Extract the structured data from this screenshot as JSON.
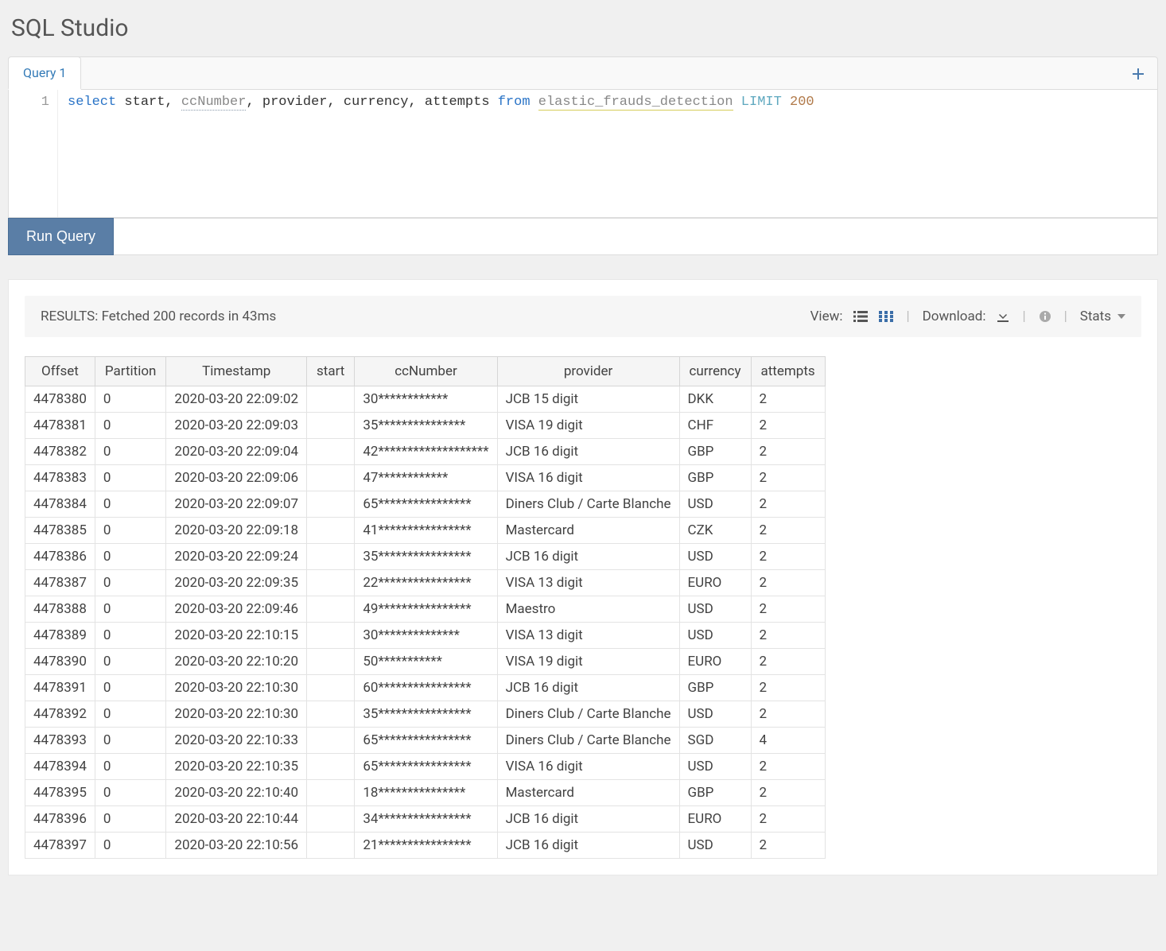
{
  "page_title": "SQL Studio",
  "tabs": [
    {
      "label": "Query 1"
    }
  ],
  "editor": {
    "line_number": "1",
    "tokens": {
      "select": "select",
      "fields": " start, ",
      "cc": "ccNumber",
      "rest": ", provider, currency, attempts ",
      "from": "from",
      "sp": " ",
      "table": "elastic_frauds_detection",
      "sp2": " ",
      "limit": "LIMIT",
      "sp3": " ",
      "num": "200"
    }
  },
  "run_button": "Run Query",
  "results": {
    "status": "RESULTS: Fetched 200 records in 43ms",
    "view_label": "View:",
    "download_label": "Download:",
    "stats_label": "Stats",
    "columns": [
      "Offset",
      "Partition",
      "Timestamp",
      "start",
      "ccNumber",
      "provider",
      "currency",
      "attempts"
    ],
    "rows": [
      {
        "offset": "4478380",
        "partition": "0",
        "timestamp": "2020-03-20 22:09:02",
        "start": "",
        "ccNumber": "30************",
        "provider": "JCB 15 digit",
        "currency": "DKK",
        "attempts": "2"
      },
      {
        "offset": "4478381",
        "partition": "0",
        "timestamp": "2020-03-20 22:09:03",
        "start": "",
        "ccNumber": "35***************",
        "provider": "VISA 19 digit",
        "currency": "CHF",
        "attempts": "2"
      },
      {
        "offset": "4478382",
        "partition": "0",
        "timestamp": "2020-03-20 22:09:04",
        "start": "",
        "ccNumber": "42*******************",
        "provider": "JCB 16 digit",
        "currency": "GBP",
        "attempts": "2"
      },
      {
        "offset": "4478383",
        "partition": "0",
        "timestamp": "2020-03-20 22:09:06",
        "start": "",
        "ccNumber": "47************",
        "provider": "VISA 16 digit",
        "currency": "GBP",
        "attempts": "2"
      },
      {
        "offset": "4478384",
        "partition": "0",
        "timestamp": "2020-03-20 22:09:07",
        "start": "",
        "ccNumber": "65****************",
        "provider": "Diners Club / Carte Blanche",
        "currency": "USD",
        "attempts": "2"
      },
      {
        "offset": "4478385",
        "partition": "0",
        "timestamp": "2020-03-20 22:09:18",
        "start": "",
        "ccNumber": "41****************",
        "provider": "Mastercard",
        "currency": "CZK",
        "attempts": "2"
      },
      {
        "offset": "4478386",
        "partition": "0",
        "timestamp": "2020-03-20 22:09:24",
        "start": "",
        "ccNumber": "35****************",
        "provider": "JCB 16 digit",
        "currency": "USD",
        "attempts": "2"
      },
      {
        "offset": "4478387",
        "partition": "0",
        "timestamp": "2020-03-20 22:09:35",
        "start": "",
        "ccNumber": "22****************",
        "provider": "VISA 13 digit",
        "currency": "EURO",
        "attempts": "2"
      },
      {
        "offset": "4478388",
        "partition": "0",
        "timestamp": "2020-03-20 22:09:46",
        "start": "",
        "ccNumber": "49****************",
        "provider": "Maestro",
        "currency": "USD",
        "attempts": "2"
      },
      {
        "offset": "4478389",
        "partition": "0",
        "timestamp": "2020-03-20 22:10:15",
        "start": "",
        "ccNumber": "30**************",
        "provider": "VISA 13 digit",
        "currency": "USD",
        "attempts": "2"
      },
      {
        "offset": "4478390",
        "partition": "0",
        "timestamp": "2020-03-20 22:10:20",
        "start": "",
        "ccNumber": "50***********",
        "provider": "VISA 19 digit",
        "currency": "EURO",
        "attempts": "2"
      },
      {
        "offset": "4478391",
        "partition": "0",
        "timestamp": "2020-03-20 22:10:30",
        "start": "",
        "ccNumber": "60****************",
        "provider": "JCB 16 digit",
        "currency": "GBP",
        "attempts": "2"
      },
      {
        "offset": "4478392",
        "partition": "0",
        "timestamp": "2020-03-20 22:10:30",
        "start": "",
        "ccNumber": "35****************",
        "provider": "Diners Club / Carte Blanche",
        "currency": "USD",
        "attempts": "2"
      },
      {
        "offset": "4478393",
        "partition": "0",
        "timestamp": "2020-03-20 22:10:33",
        "start": "",
        "ccNumber": "65****************",
        "provider": "Diners Club / Carte Blanche",
        "currency": "SGD",
        "attempts": "4"
      },
      {
        "offset": "4478394",
        "partition": "0",
        "timestamp": "2020-03-20 22:10:35",
        "start": "",
        "ccNumber": "65****************",
        "provider": "VISA 16 digit",
        "currency": "USD",
        "attempts": "2"
      },
      {
        "offset": "4478395",
        "partition": "0",
        "timestamp": "2020-03-20 22:10:40",
        "start": "",
        "ccNumber": "18***************",
        "provider": "Mastercard",
        "currency": "GBP",
        "attempts": "2"
      },
      {
        "offset": "4478396",
        "partition": "0",
        "timestamp": "2020-03-20 22:10:44",
        "start": "",
        "ccNumber": "34****************",
        "provider": "JCB 16 digit",
        "currency": "EURO",
        "attempts": "2"
      },
      {
        "offset": "4478397",
        "partition": "0",
        "timestamp": "2020-03-20 22:10:56",
        "start": "",
        "ccNumber": "21****************",
        "provider": "JCB 16 digit",
        "currency": "USD",
        "attempts": "2"
      }
    ]
  }
}
